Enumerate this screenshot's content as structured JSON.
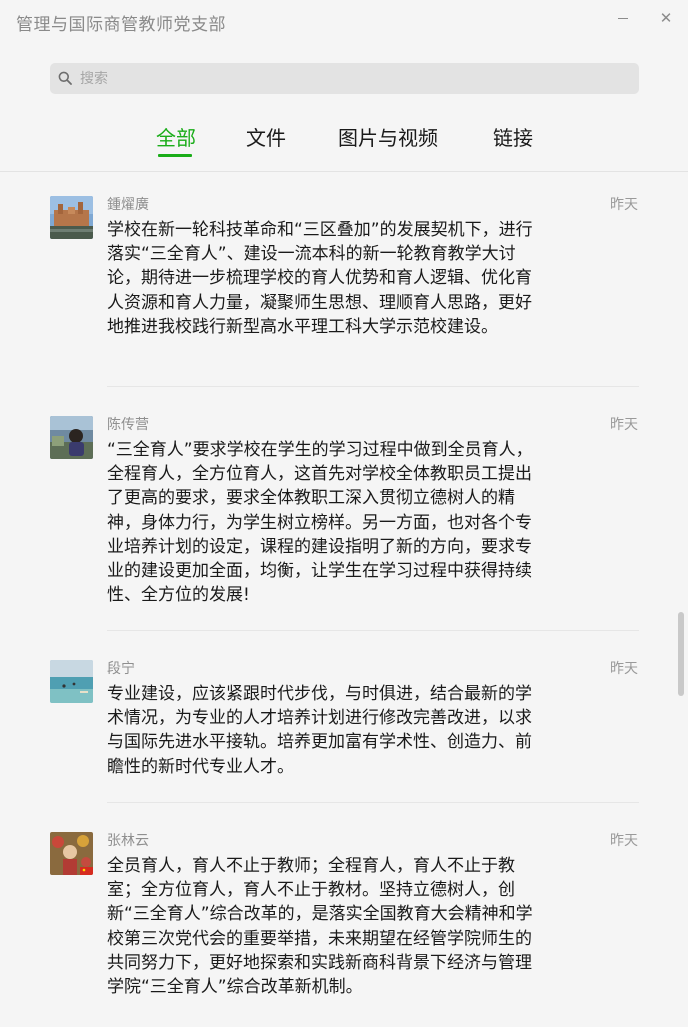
{
  "window": {
    "title": "管理与国际商管教师党支部",
    "minimize_icon": "minimize-icon",
    "close_icon": "close-icon",
    "close_glyph": "✕"
  },
  "search": {
    "placeholder": "搜索",
    "value": "",
    "icon": "search-icon"
  },
  "tabs": [
    {
      "label": "全部",
      "active": true
    },
    {
      "label": "文件",
      "active": false
    },
    {
      "label": "图片与视频",
      "active": false
    },
    {
      "label": "链接",
      "active": false
    }
  ],
  "colors": {
    "accent": "#1aad19",
    "background": "#f5f5f5",
    "text": "#1a1a1a",
    "meta": "#8f8f8f"
  },
  "messages": [
    {
      "sender": "鍾燿廣",
      "time": "昨天",
      "avatar": "avatar-castle-photo",
      "text": "学校在新一轮科技革命和“三区叠加”的发展契机下，进行落实“三全育人”、建设一流本科的新一轮教育教学大讨论，期待进一步梳理学校的育人优势和育人逻辑、优化育人资源和育人力量，凝聚师生思想、理顺育人思路，更好地推进我校践行新型高水平理工科大学示范校建设。"
    },
    {
      "sender": "陈传营",
      "time": "昨天",
      "avatar": "avatar-person-photo",
      "text": "“三全育人”要求学校在学生的学习过程中做到全员育人，全程育人，全方位育人，这首先对学校全体教职员工提出了更高的要求，要求全体教职工深入贯彻立德树人的精神，身体力行，为学生树立榜样。另一方面，也对各个专业培养计划的设定，课程的建设指明了新的方向，要求专业的建设更加全面，均衡，让学生在学习过程中获得持续性、全方位的发展!"
    },
    {
      "sender": "段宁",
      "time": "昨天",
      "avatar": "avatar-sea-photo",
      "text": "专业建设，应该紧跟时代步伐，与时俱进，结合最新的学术情况，为专业的人才培养计划进行修改完善改进，以求与国际先进水平接轨。培养更加富有学术性、创造力、前瞻性的新时代专业人才。"
    },
    {
      "sender": "张林云",
      "time": "昨天",
      "avatar": "avatar-flowers-photo",
      "text": "全员育人，育人不止于教师；全程育人，育人不止于教室；全方位育人，育人不止于教材。坚持立德树人，创新“三全育人”综合改革的，是落实全国教育大会精神和学校第三次党代会的重要举措，未来期望在经管学院师生的共同努力下，更好地探索和实践新商科背景下经济与管理学院“三全育人”综合改革新机制。"
    }
  ]
}
